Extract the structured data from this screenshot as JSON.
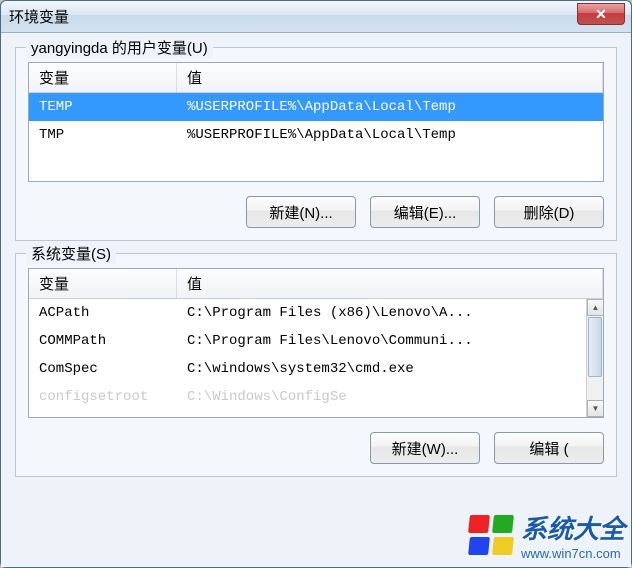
{
  "window": {
    "title": "环境变量",
    "close_glyph": "✕"
  },
  "user_section": {
    "label": "yangyingda 的用户变量(U)",
    "col_var": "变量",
    "col_val": "值",
    "rows": [
      {
        "var": "TEMP",
        "val": "%USERPROFILE%\\AppData\\Local\\Temp",
        "selected": true
      },
      {
        "var": "TMP",
        "val": "%USERPROFILE%\\AppData\\Local\\Temp",
        "selected": false
      }
    ],
    "btn_new": "新建(N)...",
    "btn_edit": "编辑(E)...",
    "btn_delete": "删除(D)"
  },
  "sys_section": {
    "label": "系统变量(S)",
    "col_var": "变量",
    "col_val": "值",
    "rows": [
      {
        "var": "ACPath",
        "val": "C:\\Program Files (x86)\\Lenovo\\A..."
      },
      {
        "var": "COMMPath",
        "val": "C:\\Program Files\\Lenovo\\Communi..."
      },
      {
        "var": "ComSpec",
        "val": "C:\\windows\\system32\\cmd.exe"
      },
      {
        "var": "configsetroot",
        "val": "C:\\Windows\\ConfigSe",
        "faded": true
      }
    ],
    "btn_new": "新建(W)...",
    "btn_edit": "编辑 (",
    "btn_delete": ""
  },
  "scroll": {
    "up": "▲",
    "down": "▼"
  },
  "watermark": {
    "big": "系统大全",
    "url": "www.win7cn.com"
  }
}
